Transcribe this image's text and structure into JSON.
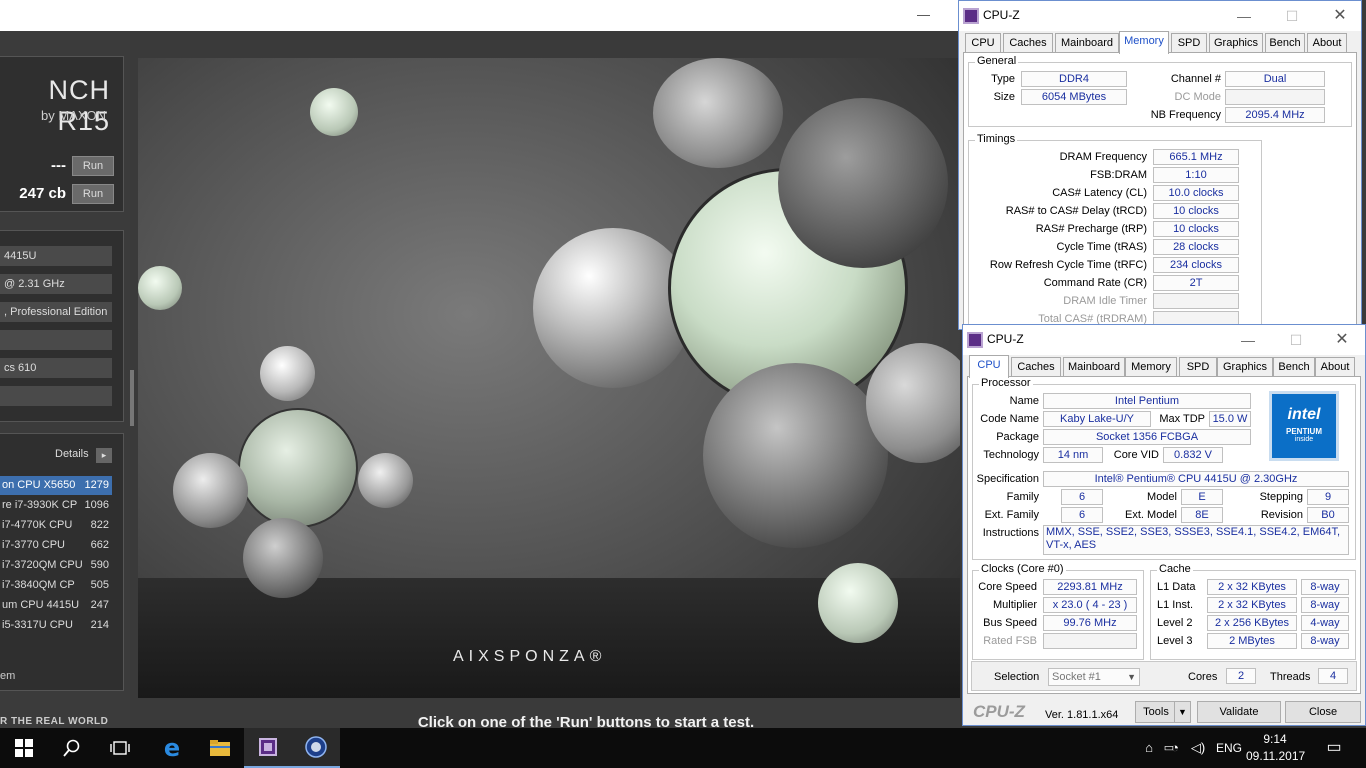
{
  "cinebench": {
    "logo_big": "NCH R15",
    "logo_small": "by MAXON",
    "opengl_score": "---",
    "cpu_score": "247 cb",
    "run_label": "Run",
    "info": [
      "4415U",
      "@ 2.31 GHz",
      ", Professional Edition",
      "",
      "cs 610",
      ""
    ],
    "details_label": "Details",
    "details_btn": "▸",
    "ranking": [
      {
        "name": "on CPU X5650",
        "value": "1279",
        "selected": true
      },
      {
        "name": "re i7-3930K CP",
        "value": "1096"
      },
      {
        "name": "i7-4770K CPU",
        "value": "822"
      },
      {
        "name": "i7-3770 CPU",
        "value": "662"
      },
      {
        "name": "i7-3720QM CPU",
        "value": "590"
      },
      {
        "name": "i7-3840QM CP",
        "value": "505"
      },
      {
        "name": "um CPU 4415U",
        "value": "247"
      },
      {
        "name": "i5-3317U CPU",
        "value": "214"
      }
    ],
    "rank_footer": "em",
    "tagline": "R THE REAL WORLD",
    "brand": "AIXSPONZA®",
    "hint": "Click on one of the 'Run' buttons to start a test."
  },
  "cpuz_memory": {
    "title": "CPU-Z",
    "tabs": [
      "CPU",
      "Caches",
      "Mainboard",
      "Memory",
      "SPD",
      "Graphics",
      "Bench",
      "About"
    ],
    "active_tab": "Memory",
    "general_title": "General",
    "type_label": "Type",
    "type": "DDR4",
    "size_label": "Size",
    "size": "6054 MBytes",
    "channel_label": "Channel #",
    "channel": "Dual",
    "dc_mode_label": "DC Mode",
    "dc_mode": "",
    "nb_freq_label": "NB Frequency",
    "nb_freq": "2095.4 MHz",
    "timings_title": "Timings",
    "timings": [
      {
        "label": "DRAM Frequency",
        "value": "665.1 MHz"
      },
      {
        "label": "FSB:DRAM",
        "value": "1:10"
      },
      {
        "label": "CAS# Latency (CL)",
        "value": "10.0 clocks"
      },
      {
        "label": "RAS# to CAS# Delay (tRCD)",
        "value": "10 clocks"
      },
      {
        "label": "RAS# Precharge (tRP)",
        "value": "10 clocks"
      },
      {
        "label": "Cycle Time (tRAS)",
        "value": "28 clocks"
      },
      {
        "label": "Row Refresh Cycle Time (tRFC)",
        "value": "234 clocks"
      },
      {
        "label": "Command Rate (CR)",
        "value": "2T"
      },
      {
        "label": "DRAM Idle Timer",
        "value": "",
        "disabled": true
      },
      {
        "label": "Total CAS# (tRDRAM)",
        "value": "",
        "disabled": true
      }
    ]
  },
  "cpuz_cpu": {
    "title": "CPU-Z",
    "tabs": [
      "CPU",
      "Caches",
      "Mainboard",
      "Memory",
      "SPD",
      "Graphics",
      "Bench",
      "About"
    ],
    "active_tab": "CPU",
    "processor_title": "Processor",
    "name_label": "Name",
    "name": "Intel Pentium",
    "codename_label": "Code Name",
    "codename": "Kaby Lake-U/Y",
    "max_tdp_label": "Max TDP",
    "max_tdp": "15.0 W",
    "package_label": "Package",
    "package": "Socket 1356 FCBGA",
    "technology_label": "Technology",
    "technology": "14 nm",
    "core_vid_label": "Core VID",
    "core_vid": "0.832 V",
    "spec_label": "Specification",
    "spec": "Intel® Pentium® CPU 4415U @ 2.30GHz",
    "family_label": "Family",
    "family": "6",
    "model_label": "Model",
    "model": "E",
    "stepping_label": "Stepping",
    "stepping": "9",
    "ext_family_label": "Ext. Family",
    "ext_family": "6",
    "ext_model_label": "Ext. Model",
    "ext_model": "8E",
    "revision_label": "Revision",
    "revision": "B0",
    "instructions_label": "Instructions",
    "instructions": "MMX, SSE, SSE2, SSE3, SSSE3, SSE4.1, SSE4.2, EM64T, VT-x, AES",
    "intel_logo_text": "intel",
    "intel_logo_sub": "PENTIUM",
    "intel_logo_inside": "inside",
    "clocks_title": "Clocks (Core #0)",
    "core_speed_label": "Core Speed",
    "core_speed": "2293.81 MHz",
    "multiplier_label": "Multiplier",
    "multiplier": "x 23.0 ( 4 - 23 )",
    "bus_speed_label": "Bus Speed",
    "bus_speed": "99.76 MHz",
    "rated_fsb_label": "Rated FSB",
    "rated_fsb": "",
    "cache_title": "Cache",
    "cache": [
      {
        "label": "L1 Data",
        "size": "2 x 32 KBytes",
        "way": "8-way"
      },
      {
        "label": "L1 Inst.",
        "size": "2 x 32 KBytes",
        "way": "8-way"
      },
      {
        "label": "Level 2",
        "size": "2 x 256 KBytes",
        "way": "4-way"
      },
      {
        "label": "Level 3",
        "size": "2 MBytes",
        "way": "8-way"
      }
    ],
    "selection_label": "Selection",
    "selection": "Socket #1",
    "cores_label": "Cores",
    "cores": "2",
    "threads_label": "Threads",
    "threads": "4",
    "brand": "CPU-Z",
    "version": "Ver. 1.81.1.x64",
    "tools_label": "Tools",
    "validate_label": "Validate",
    "close_label": "Close"
  },
  "taskbar": {
    "lang": "ENG",
    "time": "9:14",
    "date": "09.11.2017"
  },
  "colors": {
    "cpuz_value_text": "#1a2fa0",
    "active_tab_text": "#1e50c8",
    "cb_selected_row": "#3d6fae",
    "intel_blue": "#0b6fc7"
  }
}
